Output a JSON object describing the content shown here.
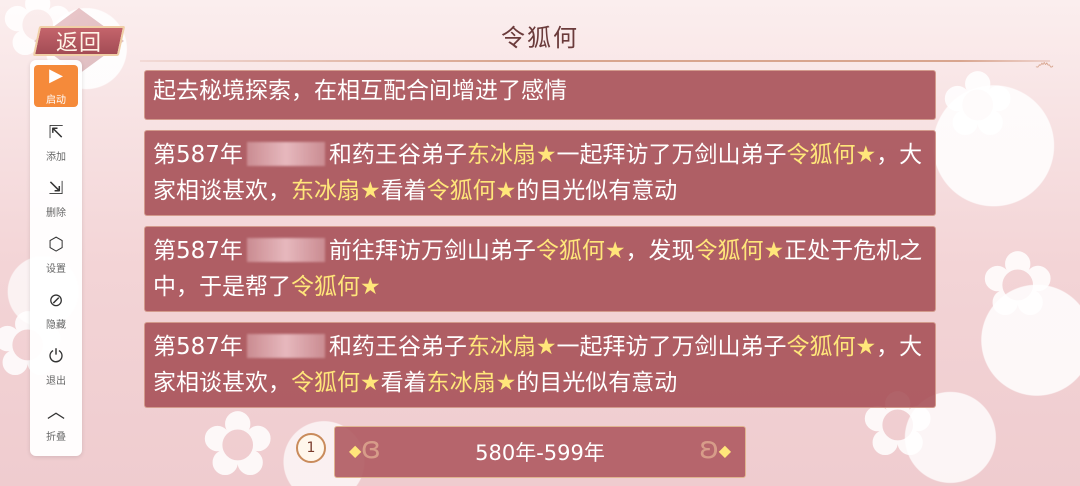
{
  "header": {
    "title": "令狐何",
    "back_label": "返回"
  },
  "sidebar": {
    "items": [
      {
        "icon": "play-icon",
        "glyph": "▶",
        "label": "启动"
      },
      {
        "icon": "cursor-add-icon",
        "glyph": "⇱",
        "label": "添加"
      },
      {
        "icon": "cursor-delete-icon",
        "glyph": "⇲",
        "label": "删除"
      },
      {
        "icon": "settings-hex-icon",
        "glyph": "⬡",
        "label": "设置"
      },
      {
        "icon": "hide-eye-icon",
        "glyph": "⊘",
        "label": "隐藏"
      },
      {
        "icon": "power-icon",
        "glyph": "⏻",
        "label": "退出"
      },
      {
        "icon": "chevron-up-icon",
        "glyph": "︿",
        "label": "折叠"
      }
    ]
  },
  "events": {
    "partial": {
      "text": "起去秘境探索，在相互配合间增进了感情"
    },
    "e1": {
      "year": "第587年",
      "p1": "和药王谷弟子",
      "n1": "东冰扇★",
      "p2": "一起拜访了万剑山弟子",
      "n2": "令狐何★",
      "p3": "，大家相谈甚欢，",
      "n3": "东冰扇★",
      "p4": "看着",
      "n4": "令狐何★",
      "p5": "的目光似有意动"
    },
    "e2": {
      "year": "第587年",
      "p1": "前往拜访万剑山弟子",
      "n1": "令狐何★",
      "p2": "，发现",
      "n2": "令狐何★",
      "p3": "正处于危机之中，于是帮了",
      "n3": "令狐何★"
    },
    "e3": {
      "year": "第587年",
      "p1": "和药王谷弟子",
      "n1": "东冰扇★",
      "p2": "一起拜访了万剑山弟子",
      "n2": "令狐何★",
      "p3": "，大家相谈甚欢，",
      "n3": "令狐何★",
      "p4": "看着",
      "n4": "东冰扇★",
      "p5": "的目光似有意动"
    }
  },
  "pager": {
    "page_number": "1",
    "range_label": "580年-599年"
  },
  "colors": {
    "card_bg": "#a54d54",
    "highlight_name": "#ffe67a",
    "accent_orange": "#f58a3a"
  }
}
